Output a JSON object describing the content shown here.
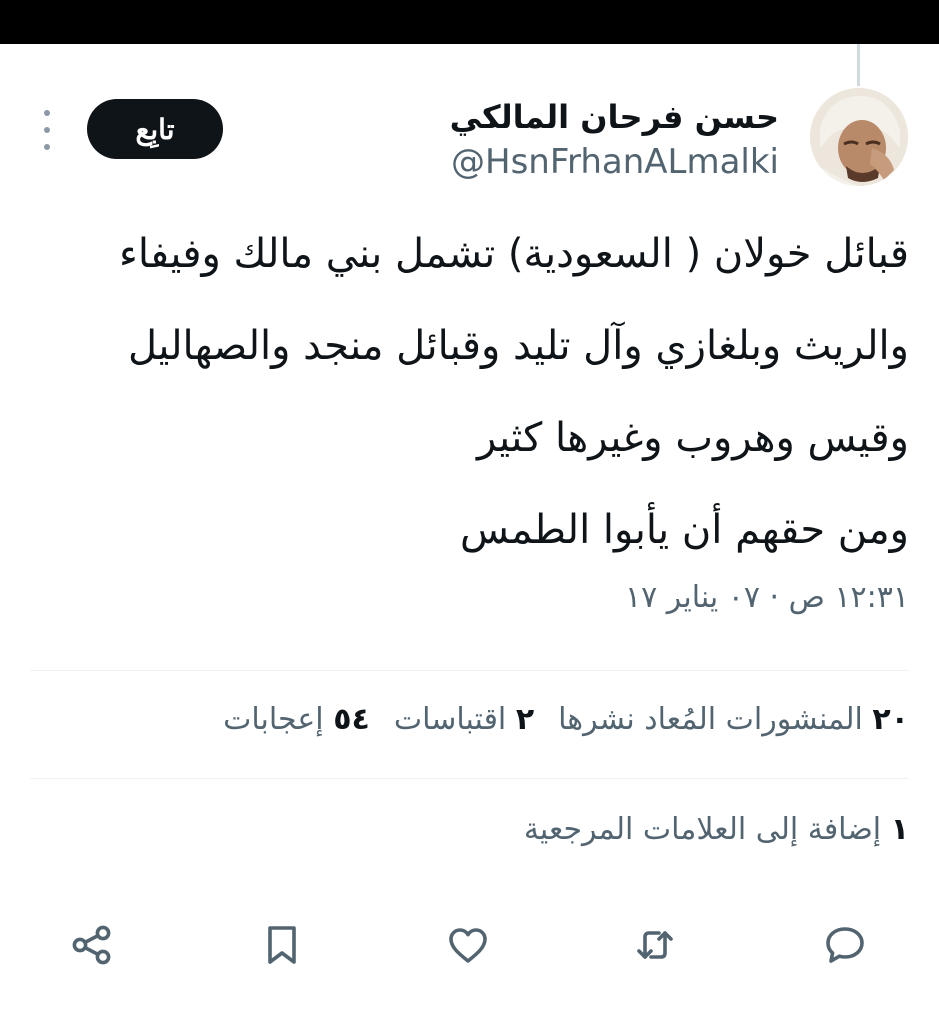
{
  "author": {
    "display_name": "حسن فرحان المالكي",
    "handle": "@HsnFrhanALmalki"
  },
  "follow_button": {
    "label": "تابِع"
  },
  "tweet": {
    "lines": [
      "قبائل خولان ( السعودية) تشمل بني مالك وفيفاء",
      "والريث وبلغازي وآل تليد وقبائل منجد والصهاليل",
      "وقيس وهروب وغيرها كثير",
      "ومن حقهم أن يأبوا الطمس"
    ],
    "timestamp": "١٢:٣١ ص · ٠٧ يناير ١٧"
  },
  "stats": {
    "reposts_count": "٢٠",
    "reposts_label": "المنشورات المُعاد نشرها",
    "quotes_count": "٢",
    "quotes_label": "اقتباسات",
    "likes_count": "٥٤",
    "likes_label": "إعجابات"
  },
  "bookmarks": {
    "count": "١",
    "label": "إضافة إلى العلامات المرجعية"
  },
  "actions": [
    "reply-icon",
    "repost-icon",
    "like-icon",
    "bookmark-icon",
    "share-icon"
  ],
  "colors": {
    "text": "#0f1419",
    "secondary": "#536471",
    "action_icon": "#536471",
    "follow_bg": "#0f1419",
    "divider": "#eff3f4"
  }
}
